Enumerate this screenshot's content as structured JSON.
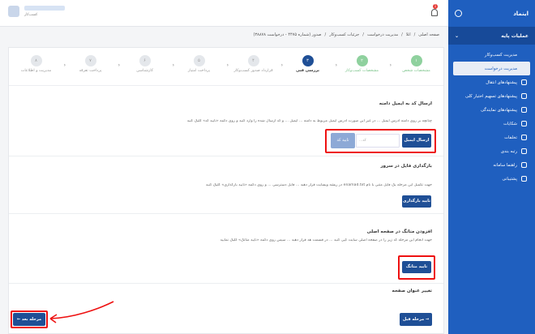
{
  "sidebar": {
    "brand": "اینماد",
    "group_label": "عملیات پایه",
    "items": [
      {
        "label": "مدیریت کسب‌وکار",
        "sub": true
      },
      {
        "label": "مدیریت درخواست",
        "sub": true,
        "active": true
      },
      {
        "label": "پیشنهادهای انتقال",
        "sub": false
      },
      {
        "label": "پیشنهادهای تسهیم اختیار کلی",
        "sub": false
      },
      {
        "label": "پیشنهادهای نمایندگی",
        "sub": false
      },
      {
        "label": "شکایات",
        "sub": false
      },
      {
        "label": "تخلفات",
        "sub": false
      },
      {
        "label": "رتبه بندی",
        "sub": false
      },
      {
        "label": "راهنما سامانه",
        "sub": false
      },
      {
        "label": "پشتیبانی",
        "sub": false
      }
    ]
  },
  "header": {
    "user_role": "کسب‌کار",
    "notif_count": "1"
  },
  "breadcrumb": [
    "صفحه اصلی",
    "/",
    "اتلا",
    "/",
    "مدیریت درخواست",
    "/",
    "جزئیات کسب‌وکار",
    "/",
    "صدور (شماره ۴۴۷۵ - درخواست ۳۸۸۷۸)"
  ],
  "steps": [
    {
      "num": "۱",
      "label": "مشخصات شخص",
      "state": "done"
    },
    {
      "num": "۲",
      "label": "مشخصات کسب‌وکار",
      "state": "done"
    },
    {
      "num": "۳",
      "label": "بررسی فنی",
      "state": "cur"
    },
    {
      "num": "۴",
      "label": "قرارداد صدور کسب‌وکار",
      "state": "todo"
    },
    {
      "num": "۵",
      "label": "پرداخت امتیاز",
      "state": "todo"
    },
    {
      "num": "۶",
      "label": "کارشناسی",
      "state": "todo"
    },
    {
      "num": "۷",
      "label": "پرداخت تعرفه",
      "state": "todo"
    },
    {
      "num": "۸",
      "label": "مدیریت و اطلاعات",
      "state": "todo"
    }
  ],
  "email_section": {
    "title": "ارسال کد به ایمیل دامنه",
    "text": "چنانچه بر روی دامنه آدرس ایمیل ... در غیر این صورت آدرس ایمیل مربوط به دامنه ... ایمیل ... و کد ارسال شده را وارد کنید و روی دکمه «تایید کد» کلیک کنید",
    "send_label": "ارسال ایمیل",
    "code_placeholder": "کد...",
    "verify_label": "تایید کد"
  },
  "upload_section": {
    "title": "بارگذاری فایل در سرور",
    "text": "جهت تکمیل این مرحله یک فایل متنی با نام enamad.txt در ریشه وبسایت قرار دهید ... فایل دسترسی ... و روی دکمه «تایید بارگذاری» کلیک کنید",
    "btn_label": "تایید بارگذاری"
  },
  "code_section": {
    "title": "افزودن متاتگ در صفحه اصلی",
    "text": "جهت انجام این مرحله کد زیر را در صفحه اصلی سایت کپی کنید ... در قسمت هد قرار دهید ... سپس روی دکمه «تایید متاتگ» کلیک نمایید",
    "btn_label": "تایید متاتگ"
  },
  "title_section": {
    "title": "تغییر عنوان صفحه"
  },
  "footer": {
    "prev_label": "مرحله قبل",
    "next_label": "مرحله بعد"
  }
}
